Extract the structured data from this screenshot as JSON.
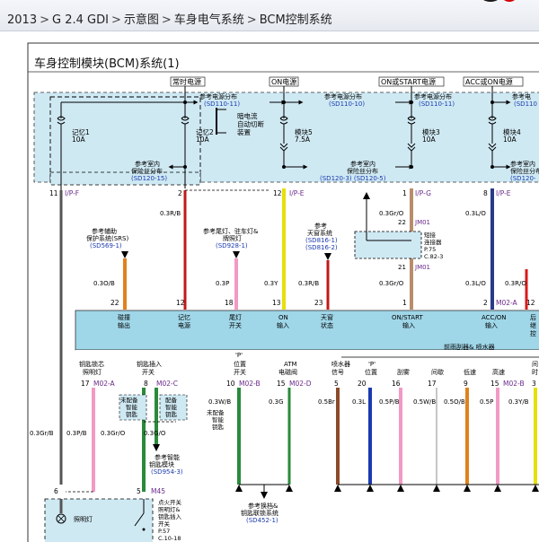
{
  "breadcrumb": [
    "2013",
    "G 2.4 GDI",
    "示意图",
    "车身电气系统",
    "BCM控制系统"
  ],
  "breadcrumb_sep": ">",
  "diagram": {
    "title": "车身控制模块(BCM)系统(1)",
    "top_headers": [
      "常时电源",
      "ON电源",
      "ON或START电源",
      "ACC或ON电源"
    ],
    "power_dist_1": [
      "参考电源分布",
      "(SD110-11)"
    ],
    "power_dist_2": [
      "参考电源分布",
      "(SD110-10)"
    ],
    "power_dist_3": [
      "参考电源分布",
      "(SD110-11)"
    ],
    "power_dist_4_partial": [
      "参考电",
      "(SD110"
    ],
    "dark_current_note": [
      "暗电流",
      "自动切断",
      "装置"
    ],
    "fuses": [
      {
        "label": "记忆1",
        "rating": "10A"
      },
      {
        "label": "记忆2",
        "rating": "10A"
      },
      {
        "label": "模块5",
        "rating": "7.5A"
      },
      {
        "label": "模块3",
        "rating": "10A"
      },
      {
        "label": "模块4",
        "rating": "10A"
      }
    ],
    "indoor_fuse_1": [
      "参考室内",
      "保险丝分布",
      "(SD120-15)"
    ],
    "indoor_fuse_2": [
      "参考室内",
      "保险丝分布",
      "(SD120-3) (SD120-5)"
    ],
    "indoor_fuse_3_partial": [
      "参考室内",
      "保险丝分布",
      "(SD120-"
    ],
    "top_pins": [
      {
        "num": "11",
        "conn": "I/P-F"
      },
      {
        "num": "2",
        "conn": ""
      },
      {
        "num": "12",
        "conn": "I/P-E"
      },
      {
        "num": "1",
        "conn": "I/P-G"
      },
      {
        "num": "8",
        "conn": "I/P-E"
      }
    ],
    "wire_labels": {
      "w_03RB": "0.3R/B",
      "w_03GrO_top": "0.3Gr/O",
      "w_03LO_top": "0.3L/O",
      "w_03OB": "0.3O/B",
      "w_03P": "0.3P",
      "w_03Y": "0.3Y",
      "w_03RB2": "0.3R/B",
      "w_03GrO_mid": "0.3Gr/O",
      "w_03LO_mid": "0.3L/O",
      "w_03RO": "0.3R/O"
    },
    "jm01_a": {
      "pin": "22",
      "name": "JM01"
    },
    "jm01_b": {
      "pin": "21",
      "name": "JM01"
    },
    "short_connector": [
      "短接",
      "连接器",
      "P.75",
      "C.82-3"
    ],
    "ref_srs": [
      "参考辅助",
      "保护系统(SRS)",
      "(SD569-1)"
    ],
    "ref_tail": [
      "参考尾灯、驻车灯&",
      "牌照灯",
      "(SD928-1)"
    ],
    "ref_sunroof": [
      "参考",
      "天窗系统",
      "(SD816-1)",
      "(SD816-2)"
    ],
    "mid_pins": [
      {
        "num": "22",
        "conn": ""
      },
      {
        "num": "12",
        "conn": ""
      },
      {
        "num": "18",
        "conn": ""
      },
      {
        "num": "13",
        "conn": ""
      },
      {
        "num": "23",
        "conn": ""
      },
      {
        "num": "1",
        "conn": ""
      },
      {
        "num": "2",
        "conn": "M02-A"
      },
      {
        "num": "12",
        "conn": ""
      }
    ],
    "bcm_inputs": [
      [
        "碰撞",
        "输出"
      ],
      [
        "记忆",
        "电源"
      ],
      [
        "尾灯",
        "开关"
      ],
      [
        "ON",
        "输入"
      ],
      [
        "天窗",
        "状态"
      ],
      [
        "ON/START",
        "输入"
      ],
      [
        "ACC/ON",
        "输入"
      ],
      [
        "后",
        "继",
        "控"
      ]
    ],
    "wiper_group": "前雨刮器& 喷水器",
    "lower_labels": [
      [
        "钥匙锁芯",
        "照明灯"
      ],
      [
        "钥匙插入",
        "开关"
      ],
      [
        "'P'",
        "位置",
        "开关"
      ],
      [
        "ATM",
        "电磁阀"
      ],
      [
        "喷水器",
        "信号"
      ],
      [
        "'P'",
        "位置"
      ],
      [
        "刮雾"
      ],
      [
        "间歇"
      ],
      [
        "低速"
      ],
      [
        "高速"
      ],
      [
        "间",
        "时"
      ]
    ],
    "lower_pins": [
      {
        "num": "17",
        "conn": "M02-A"
      },
      {
        "num": "8",
        "conn": "M02-C"
      },
      {
        "num": "10",
        "conn": "M02-B"
      },
      {
        "num": "15",
        "conn": "M02-D"
      },
      {
        "num": "5",
        "conn": ""
      },
      {
        "num": "20",
        "conn": ""
      },
      {
        "num": "16",
        "conn": ""
      },
      {
        "num": "17",
        "conn": ""
      },
      {
        "num": "9",
        "conn": ""
      },
      {
        "num": "15",
        "conn": "M02-B"
      },
      {
        "num": "3",
        "conn": ""
      }
    ],
    "not_equipped_key_1": [
      "未配备",
      "智能",
      "钥匙"
    ],
    "equipped_key": [
      "配备",
      "智能",
      "钥匙"
    ],
    "not_equipped_key_2": [
      "未配备",
      "智能",
      "钥匙"
    ],
    "lower_wire_labels": {
      "l_03GrB": "0.3Gr/B",
      "l_03PB": "0.3P/B",
      "l_03GrO_a": "0.3Gr/O",
      "l_03GrO_b": "0.3G/O",
      "l_03WB": "0.3W/B",
      "l_03G": "0.3G",
      "l_05Br": "0.5Br",
      "l_03L": "0.3L",
      "l_05PB": "0.5P/B",
      "l_05WB": "0.5W/B",
      "l_05OB": "0.5O/B",
      "l_05P": "0.5P",
      "l_03YB": "0.3Y/B"
    },
    "ref_smart_key": [
      "参考智能",
      "钥匙模块",
      "(SD954-3)"
    ],
    "ref_shift_lock": [
      "参考换档&",
      "钥匙联锁系统",
      "(SD452-1)"
    ],
    "bottom_pins": {
      "p6": "6",
      "p5": "5",
      "m45": "M45"
    },
    "ignition_switch": [
      "点火开关",
      "照明灯&",
      "钥匙插入",
      "开关",
      "P.57",
      "C.10-18"
    ],
    "lamp_label": "照明灯",
    "colors": {
      "fuse_box_bg": "#cfe9f3",
      "bcm_bg": "#9fd6e8",
      "ref_blue": "#1a3ab0",
      "connector_purple": "#6a2a8a"
    }
  }
}
